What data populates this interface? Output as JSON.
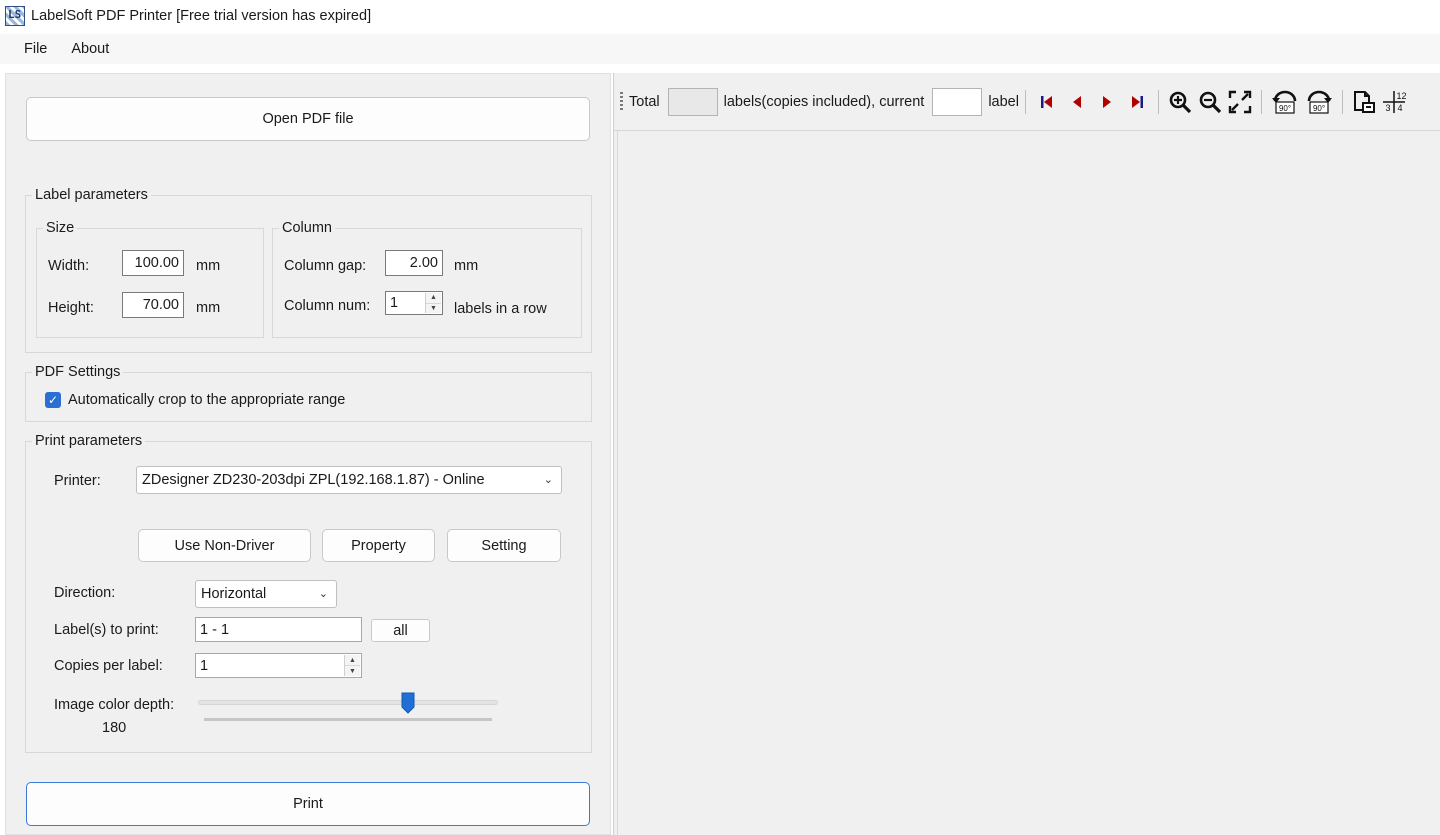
{
  "window": {
    "title": "LabelSoft PDF Printer [Free trial version has expired]",
    "icon_text": "LS"
  },
  "menu": {
    "items": [
      "File",
      "About"
    ]
  },
  "open_button": "Open PDF file",
  "label_params": {
    "title": "Label parameters",
    "size": {
      "title": "Size",
      "width_label": "Width:",
      "width_value": "100.00",
      "width_unit": "mm",
      "height_label": "Height:",
      "height_value": "70.00",
      "height_unit": "mm"
    },
    "column": {
      "title": "Column",
      "gap_label": "Column gap:",
      "gap_value": "2.00",
      "gap_unit": "mm",
      "num_label": "Column num:",
      "num_value": "1",
      "num_suffix": "labels in a row"
    }
  },
  "pdf_settings": {
    "title": "PDF Settings",
    "autocrop_label": "Automatically crop to the appropriate range",
    "autocrop_checked": true
  },
  "print_params": {
    "title": "Print parameters",
    "printer_label": "Printer:",
    "printer_value": "ZDesigner ZD230-203dpi ZPL(192.168.1.87) - Online",
    "buttons": {
      "non_driver": "Use Non-Driver",
      "property": "Property",
      "setting": "Setting"
    },
    "direction_label": "Direction:",
    "direction_value": "Horizontal",
    "labels_label": "Label(s) to print:",
    "labels_value": "1 - 1",
    "all_button": "all",
    "copies_label": "Copies per label:",
    "copies_value": "1",
    "depth_label": "Image color depth:",
    "depth_value": "180",
    "depth_slider_fraction": 0.7
  },
  "print_button": "Print",
  "toolbar": {
    "total_label": "Total",
    "total_value": "",
    "labels_text": "labels(copies included), current",
    "current_value": "",
    "label_text": "label",
    "icons": [
      "first-page-icon",
      "prev-page-icon",
      "next-page-icon",
      "last-page-icon",
      "zoom-in-icon",
      "zoom-out-icon",
      "fit-page-icon",
      "rotate-left-90-icon",
      "rotate-right-90-icon",
      "page-setup-icon",
      "page-order-icon"
    ],
    "rotate_text": "90°",
    "order_digits": [
      "1",
      "2",
      "3",
      "4"
    ]
  },
  "colors": {
    "accent": "#2a6fd1",
    "nav_red": "#b00000",
    "nav_dark": "#1a1a8a"
  }
}
